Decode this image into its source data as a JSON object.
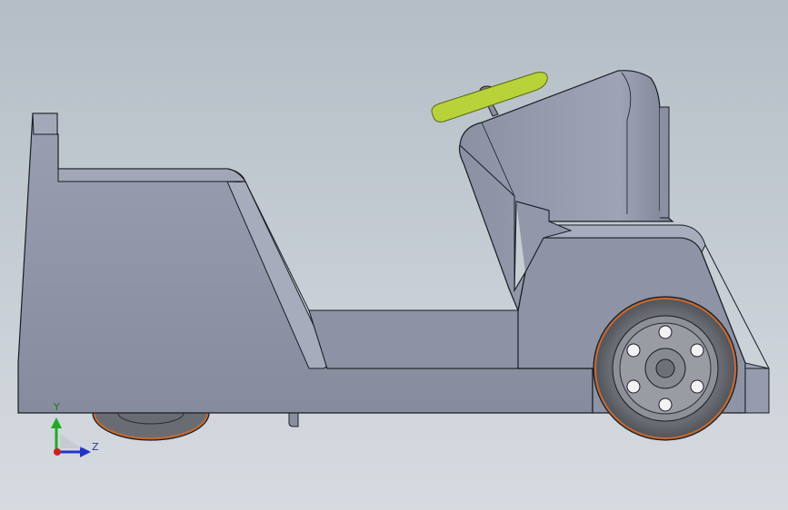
{
  "window": {
    "title": ""
  },
  "triad": {
    "y_label": "Y",
    "z_label": "Z"
  },
  "colors": {
    "background_top": "#b4bdc6",
    "background_bottom": "#d6dbe0",
    "body_fill": "#8f94a6",
    "body_dark": "#7a7f92",
    "body_light": "#a3a8b8",
    "edge": "#1b1d24",
    "steering_wheel": "#b8d23a",
    "tire": "#5c5e66",
    "tire_rim_orange": "#c8692a",
    "axis_x": "#cc2222",
    "axis_y": "#22aa22",
    "axis_z": "#2233cc"
  },
  "icons": {
    "triad": "coordinate-triad-icon"
  }
}
